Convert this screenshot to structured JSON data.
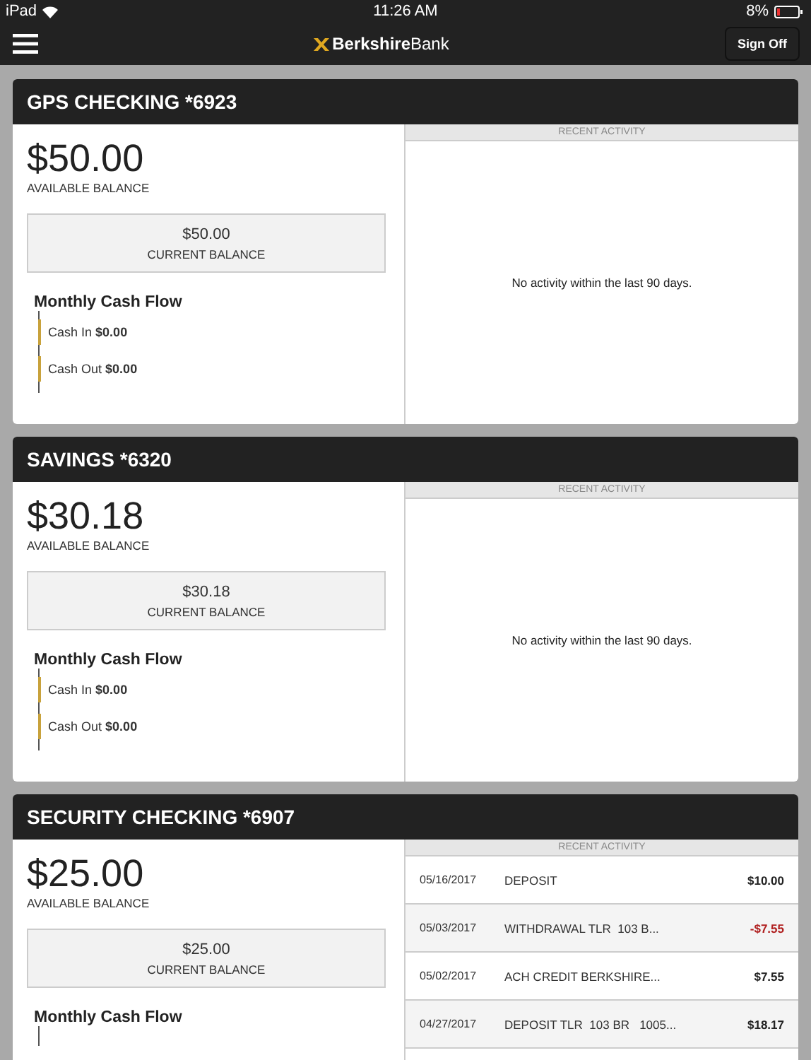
{
  "status_bar": {
    "device": "iPad",
    "time": "11:26 AM",
    "battery": "8%"
  },
  "nav": {
    "brand_bold": "Berkshire",
    "brand_light": "Bank",
    "sign_off": "Sign Off"
  },
  "accounts": [
    {
      "title": "GPS CHECKING *6923",
      "available": "$50.00",
      "available_label": "AVAILABLE BALANCE",
      "current": "$50.00",
      "current_label": "CURRENT BALANCE",
      "cash_flow_title": "Monthly Cash Flow",
      "cash_flow": [
        {
          "label": "Cash In",
          "amount": "$0.00"
        },
        {
          "label": "Cash Out",
          "amount": "$0.00"
        }
      ],
      "activity_title": "RECENT ACTIVITY",
      "empty_message": "No activity within the last 90 days."
    },
    {
      "title": "SAVINGS *6320",
      "available": "$30.18",
      "available_label": "AVAILABLE BALANCE",
      "current": "$30.18",
      "current_label": "CURRENT BALANCE",
      "cash_flow_title": "Monthly Cash Flow",
      "cash_flow": [
        {
          "label": "Cash In",
          "amount": "$0.00"
        },
        {
          "label": "Cash Out",
          "amount": "$0.00"
        }
      ],
      "activity_title": "RECENT ACTIVITY",
      "empty_message": "No activity within the last 90 days."
    },
    {
      "title": "SECURITY CHECKING *6907",
      "available": "$25.00",
      "available_label": "AVAILABLE BALANCE",
      "current": "$25.00",
      "current_label": "CURRENT BALANCE",
      "cash_flow_title": "Monthly Cash Flow",
      "activity_title": "RECENT ACTIVITY",
      "transactions": [
        {
          "date": "05/16/2017",
          "description": "DEPOSIT",
          "amount": "$10.00",
          "kind": "credit"
        },
        {
          "date": "05/03/2017",
          "description": "WITHDRAWAL TLR  103 B...",
          "amount": "-$7.55",
          "kind": "debit"
        },
        {
          "date": "05/02/2017",
          "description": "ACH CREDIT BERKSHIRE...",
          "amount": "$7.55",
          "kind": "credit"
        },
        {
          "date": "04/27/2017",
          "description": "DEPOSIT TLR  103 BR   1005...",
          "amount": "$18.17",
          "kind": "credit"
        }
      ]
    }
  ]
}
